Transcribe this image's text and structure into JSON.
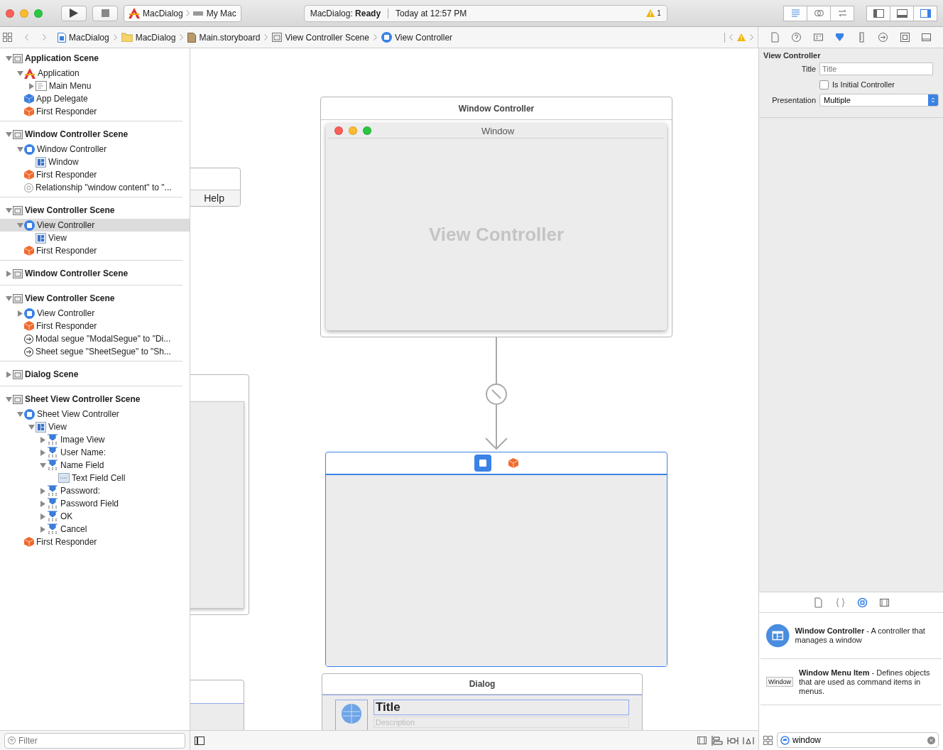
{
  "toolbar": {
    "scheme": {
      "project": "MacDialog",
      "destination": "My Mac"
    },
    "activity": {
      "status": "MacDialog: **Ready**",
      "time": "Today at 12:57 PM",
      "warnings": "1"
    },
    "editor_modes": [
      {
        "kind": "standard",
        "selected": true
      },
      {
        "kind": "assistant",
        "selected": false
      },
      {
        "kind": "version",
        "selected": false
      }
    ],
    "panel_toggles": [
      {
        "kind": "navigator",
        "on": false
      },
      {
        "kind": "debug",
        "on": false
      },
      {
        "kind": "utilities",
        "on": true
      }
    ]
  },
  "jump_bar": {
    "path": [
      {
        "kind": "project",
        "label": "MacDialog"
      },
      {
        "kind": "folder",
        "label": "MacDialog"
      },
      {
        "kind": "storyboard",
        "label": "Main.storyboard"
      },
      {
        "kind": "scene",
        "label": "View Controller Scene"
      },
      {
        "kind": "view-controller",
        "label": "View Controller"
      }
    ]
  },
  "outline": [
    {
      "kind": "scene",
      "label": "Application Scene",
      "expanded": true,
      "selected": false,
      "children": [
        {
          "kind": "app",
          "label": "Application",
          "expanded": true,
          "selected": false,
          "children": [
            {
              "kind": "menu",
              "label": "Main Menu",
              "expanded": false,
              "selected": false
            }
          ]
        },
        {
          "kind": "delegate",
          "label": "App Delegate",
          "selected": false
        },
        {
          "kind": "responder",
          "label": "First Responder",
          "selected": false
        }
      ]
    },
    {
      "kind": "scene",
      "label": "Window Controller Scene",
      "expanded": true,
      "selected": false,
      "children": [
        {
          "kind": "controller",
          "label": "Window Controller",
          "expanded": true,
          "selected": false,
          "children": [
            {
              "kind": "window",
              "label": "Window",
              "selected": false
            }
          ]
        },
        {
          "kind": "responder",
          "label": "First Responder",
          "selected": false
        },
        {
          "kind": "relationship",
          "label": "Relationship \"window content\" to \"...",
          "selected": false
        }
      ]
    },
    {
      "kind": "scene",
      "label": "View Controller Scene",
      "expanded": true,
      "selected": false,
      "children": [
        {
          "kind": "controller",
          "label": "View Controller",
          "expanded": true,
          "selected": true,
          "children": [
            {
              "kind": "window",
              "label": "View",
              "selected": false
            }
          ]
        },
        {
          "kind": "responder",
          "label": "First Responder",
          "selected": false
        }
      ]
    },
    {
      "kind": "scene",
      "label": "Window Controller Scene",
      "expanded": false,
      "selected": false
    },
    {
      "kind": "scene",
      "label": "View Controller Scene",
      "expanded": true,
      "selected": false,
      "children": [
        {
          "kind": "controller",
          "label": "View Controller",
          "expanded": false,
          "selected": false
        },
        {
          "kind": "responder",
          "label": "First Responder",
          "selected": false
        },
        {
          "kind": "segue",
          "label": "Modal segue \"ModalSegue\" to \"Di...",
          "selected": false
        },
        {
          "kind": "segue",
          "label": "Sheet segue \"SheetSegue\" to \"Sh...",
          "selected": false
        }
      ]
    },
    {
      "kind": "scene",
      "label": "Dialog Scene",
      "expanded": false,
      "selected": false
    },
    {
      "kind": "scene",
      "label": "Sheet View Controller Scene",
      "expanded": true,
      "selected": false,
      "children": [
        {
          "kind": "controller",
          "label": "Sheet View Controller",
          "expanded": true,
          "selected": false,
          "children": [
            {
              "kind": "window",
              "label": "View",
              "expanded": true,
              "selected": false,
              "children": [
                {
                  "kind": "control",
                  "label": "Image View",
                  "expanded": false,
                  "selected": false
                },
                {
                  "kind": "control",
                  "label": "User Name:",
                  "expanded": false,
                  "selected": false
                },
                {
                  "kind": "control",
                  "label": "Name Field",
                  "expanded": true,
                  "selected": false,
                  "children": [
                    {
                      "kind": "cell",
                      "label": "Text Field Cell",
                      "selected": false
                    }
                  ]
                },
                {
                  "kind": "control",
                  "label": "Password:",
                  "expanded": false,
                  "selected": false
                },
                {
                  "kind": "control",
                  "label": "Password Field",
                  "expanded": false,
                  "selected": false
                },
                {
                  "kind": "control",
                  "label": "OK",
                  "expanded": false,
                  "selected": false
                },
                {
                  "kind": "control",
                  "label": "Cancel",
                  "expanded": false,
                  "selected": false
                }
              ]
            }
          ]
        },
        {
          "kind": "responder",
          "label": "First Responder",
          "selected": false
        }
      ]
    }
  ],
  "filter": {
    "placeholder": "Filter"
  },
  "canvas": {
    "menu_scene": {
      "menu_title": "Help"
    },
    "window_controller_scene": {
      "title": "Window Controller",
      "window_title": "Window",
      "content_label": "View Controller"
    },
    "dialog_scene": {
      "title": "Dialog",
      "heading": "Title",
      "description": "Description"
    }
  },
  "inspector": {
    "tabs": [
      {
        "kind": "file",
        "selected": false
      },
      {
        "kind": "help",
        "selected": false
      },
      {
        "kind": "identity",
        "selected": false
      },
      {
        "kind": "attributes",
        "selected": true
      },
      {
        "kind": "size",
        "selected": false
      },
      {
        "kind": "connections",
        "selected": false
      },
      {
        "kind": "bindings",
        "selected": false
      },
      {
        "kind": "effects",
        "selected": false
      }
    ],
    "section": "View Controller",
    "title_field": {
      "label": "Title",
      "placeholder": "Title"
    },
    "initial_controller": {
      "label": "Is Initial Controller",
      "checked": false
    },
    "presentation": {
      "label": "Presentation",
      "value": "Multiple"
    }
  },
  "library": {
    "tabs": [
      {
        "kind": "file",
        "selected": false
      },
      {
        "kind": "snippet",
        "selected": false
      },
      {
        "kind": "object",
        "selected": true
      },
      {
        "kind": "media",
        "selected": false
      }
    ],
    "items": [
      {
        "kind": "window-controller",
        "text": "**Window Controller** - A controller that manages a window"
      },
      {
        "kind": "menu-item",
        "preview": "Window",
        "text": "**Window Menu Item** - Defines objects that are used as command items in menus."
      }
    ],
    "search": {
      "value": "window"
    }
  }
}
